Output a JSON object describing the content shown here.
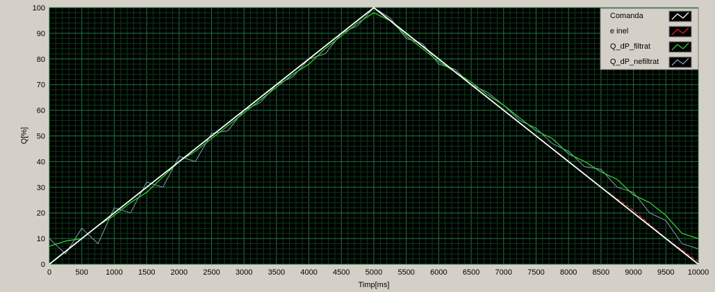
{
  "chart_data": {
    "type": "line",
    "xlabel": "Timp[ms]",
    "ylabel": "Q[%]",
    "xlim": [
      0,
      10000
    ],
    "ylim": [
      0,
      100
    ],
    "x_ticks": [
      0,
      500,
      1000,
      1500,
      2000,
      2500,
      3000,
      3500,
      4000,
      4500,
      5000,
      5500,
      6000,
      6500,
      7000,
      7500,
      8000,
      8500,
      9000,
      9500,
      10000
    ],
    "y_ticks": [
      0,
      10,
      20,
      30,
      40,
      50,
      60,
      70,
      80,
      90,
      100
    ],
    "grid": true,
    "legend_position": "top-right",
    "series": [
      {
        "name": "Comanda",
        "color": "#ffffff",
        "x": [
          0,
          5000,
          10000
        ],
        "y": [
          0,
          100,
          0
        ]
      },
      {
        "name": "e inel",
        "color": "#e02020",
        "x": [
          0,
          1000,
          2000,
          3000,
          4000,
          5000,
          6000,
          7000,
          7500,
          8000,
          8500,
          9000,
          9500,
          10000
        ],
        "y": [
          0,
          20,
          40,
          60,
          80,
          100,
          80,
          60,
          50,
          40,
          30,
          21,
          10,
          1
        ]
      },
      {
        "name": "Q_dP_filtrat",
        "color": "#30d030",
        "x": [
          0,
          250,
          500,
          750,
          1000,
          1250,
          1500,
          1750,
          2000,
          2250,
          2500,
          2750,
          3000,
          3250,
          3500,
          3750,
          4000,
          4250,
          4500,
          4750,
          5000,
          5250,
          5500,
          5750,
          6000,
          6250,
          6500,
          6750,
          7000,
          7250,
          7500,
          7750,
          8000,
          8250,
          8500,
          8750,
          9000,
          9250,
          9500,
          9750,
          10000
        ],
        "y": [
          7,
          9,
          10,
          15,
          19,
          24,
          28,
          34,
          40,
          44,
          49,
          54,
          59,
          64,
          69,
          74,
          78,
          84,
          89,
          94,
          98,
          95,
          89,
          84,
          79,
          75,
          71,
          66,
          62,
          57,
          52,
          49,
          43,
          40,
          36,
          33,
          27,
          24,
          19,
          12,
          10
        ]
      },
      {
        "name": "Q_dP_nefiltrat",
        "color": "#8a9ab8",
        "x": [
          0,
          250,
          500,
          750,
          1000,
          1250,
          1500,
          1750,
          2000,
          2250,
          2500,
          2750,
          3000,
          3250,
          3500,
          3750,
          4000,
          4250,
          4500,
          4750,
          5000,
          5250,
          5500,
          5750,
          6000,
          6250,
          6500,
          6750,
          7000,
          7250,
          7500,
          7750,
          8000,
          8250,
          8500,
          8750,
          9000,
          9250,
          9500,
          9750,
          10000
        ],
        "y": [
          10,
          4,
          14,
          8,
          22,
          20,
          32,
          30,
          42,
          40,
          51,
          52,
          60,
          63,
          70,
          73,
          80,
          82,
          90,
          93,
          100,
          96,
          88,
          86,
          78,
          76,
          70,
          67,
          62,
          56,
          53,
          47,
          44,
          38,
          37,
          30,
          28,
          20,
          17,
          8,
          6
        ]
      }
    ]
  }
}
